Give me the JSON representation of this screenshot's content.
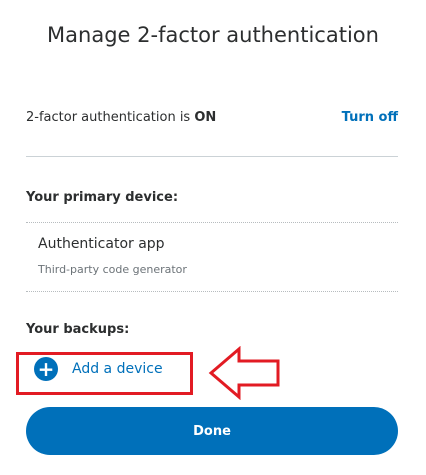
{
  "header": {
    "title": "Manage 2-factor authentication"
  },
  "status": {
    "prefix": "2-factor authentication is ",
    "state": "ON",
    "turn_off_label": "Turn off"
  },
  "primary": {
    "label": "Your primary device:",
    "device_name": "Authenticator app",
    "device_description": "Third-party code generator"
  },
  "backups": {
    "label": "Your backups:",
    "add_device_label": "Add a device",
    "add_icon": "plus-circle-icon"
  },
  "footer": {
    "done_label": "Done"
  },
  "colors": {
    "accent": "#0070ba",
    "annotation": "#e21b23",
    "text": "#2c2e2f",
    "muted": "#6c7378"
  }
}
